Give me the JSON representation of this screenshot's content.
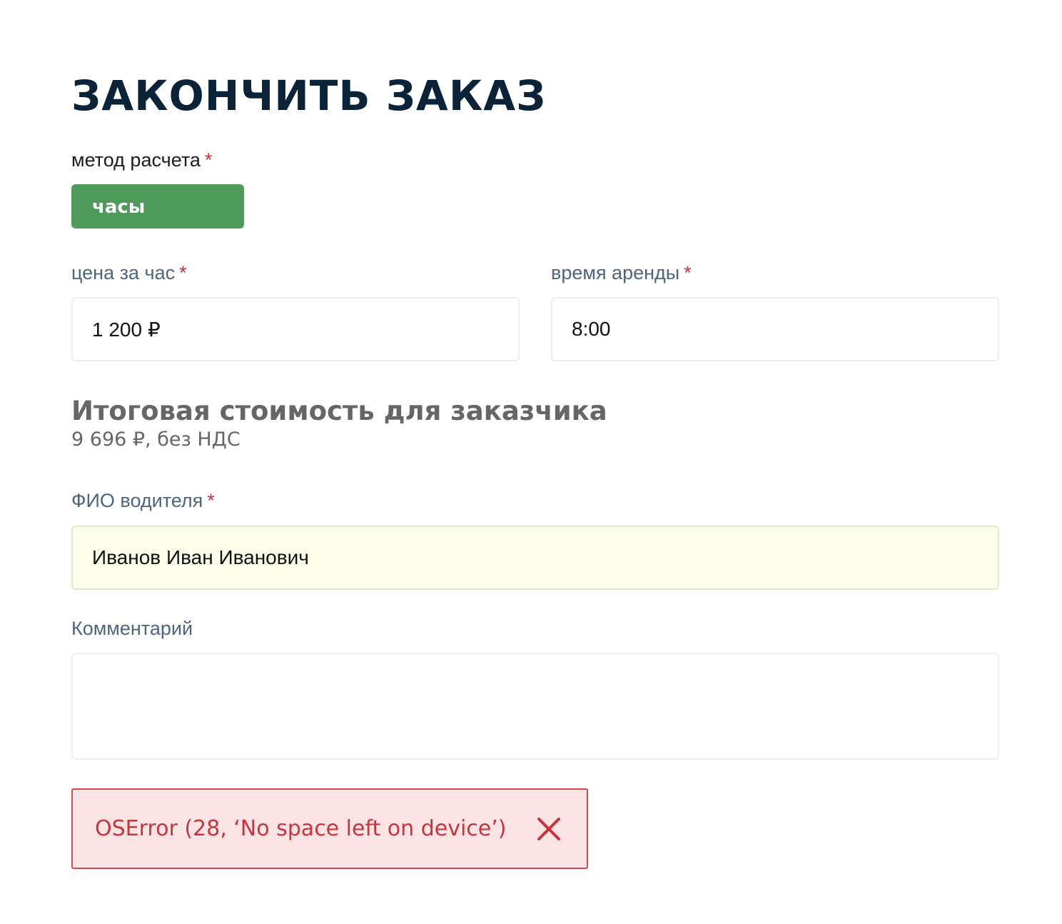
{
  "header": {
    "title": "ЗАКОНЧИТЬ ЗАКАЗ"
  },
  "form": {
    "required_mark": "*",
    "payment_method": {
      "label": "метод расчета",
      "selected": "часы"
    },
    "price_per_hour": {
      "label": "цена за час",
      "value": "1 200 ₽"
    },
    "rental_time": {
      "label": "время аренды",
      "value": "8:00"
    },
    "total": {
      "title": "Итоговая стоимость для заказчика",
      "value": "9 696 ₽, без НДС"
    },
    "driver_name": {
      "label": "ФИО водителя",
      "value": "Иванов Иван Иванович"
    },
    "comment": {
      "label": "Комментарий",
      "value": ""
    }
  },
  "error": {
    "message": "OSError (28, ‘No space left on device’)",
    "close_icon": "close-icon"
  },
  "colors": {
    "title": "#0b2338",
    "accent_green": "#4e9a5b",
    "required": "#c8343e",
    "error_bg": "#fde4e4",
    "error_border": "#d04a4f",
    "autofill_bg": "#fdfeea"
  }
}
